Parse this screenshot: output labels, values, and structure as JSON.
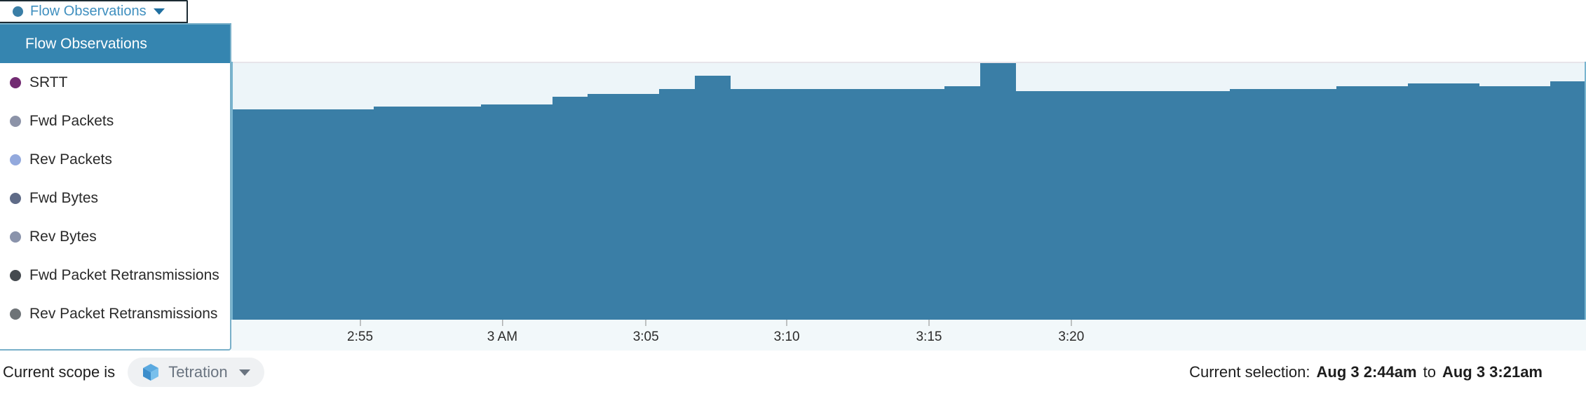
{
  "metric_selector": {
    "selected_label": "Flow Observations",
    "selected_dot_color": "#3a7ea6",
    "caret_icon": "chevron-down-icon",
    "options": [
      {
        "label": "Flow Observations",
        "color": "#3a7ea6",
        "selected": true
      },
      {
        "label": "SRTT",
        "color": "#722b72",
        "selected": false
      },
      {
        "label": "Fwd Packets",
        "color": "#8c93a8",
        "selected": false
      },
      {
        "label": "Rev Packets",
        "color": "#93a9dd",
        "selected": false
      },
      {
        "label": "Fwd Bytes",
        "color": "#5f6b87",
        "selected": false
      },
      {
        "label": "Rev Bytes",
        "color": "#8a93ab",
        "selected": false
      },
      {
        "label": "Fwd Packet Retransmissions",
        "color": "#454a4f",
        "selected": false
      },
      {
        "label": "Rev Packet Retransmissions",
        "color": "#6e7377",
        "selected": false
      }
    ]
  },
  "footer": {
    "scope_label": "Current scope is",
    "scope_name": "Tetration",
    "scope_icon": "cube-icon",
    "scope_caret_icon": "chevron-down-icon",
    "selection_prefix": "Current selection:",
    "selection_start": "Aug 3 2:44am",
    "selection_joiner": "to",
    "selection_end": "Aug 3 3:21am"
  },
  "chart_data": {
    "type": "bar",
    "title": "",
    "xlabel": "",
    "ylabel": "",
    "series_name": "Flow Observations",
    "bar_color": "#3a7ea6",
    "plot_background": "#edf5f9",
    "grid": false,
    "legend": "none",
    "xlim": [
      "2:44am",
      "3:21am"
    ],
    "ylim": [
      0,
      100
    ],
    "tick_labels": [
      "2:55",
      "3 AM",
      "3:05",
      "3:10",
      "3:15",
      "3:20"
    ],
    "tick_positions_pct": [
      9.5,
      20.0,
      30.6,
      41.0,
      51.5,
      62.0
    ],
    "x": [
      "2:44",
      "2:45",
      "2:46",
      "2:47",
      "2:48",
      "2:49",
      "2:50",
      "2:51",
      "2:52",
      "2:53",
      "2:54",
      "2:55",
      "2:56",
      "2:57",
      "2:58",
      "2:59",
      "3:00",
      "3:01",
      "3:02",
      "3:03",
      "3:04",
      "3:05",
      "3:06",
      "3:07",
      "3:08",
      "3:09",
      "3:10",
      "3:11",
      "3:12",
      "3:13",
      "3:14",
      "3:15",
      "3:16",
      "3:17",
      "3:18",
      "3:19",
      "3:20",
      "3:21"
    ],
    "values": [
      82,
      82,
      82,
      82,
      83,
      83,
      83,
      84,
      84,
      87,
      88,
      88,
      90,
      95,
      90,
      90,
      90,
      90,
      90,
      90,
      91,
      100,
      89,
      89,
      89,
      89,
      89,
      89,
      90,
      90,
      90,
      91,
      91,
      92,
      92,
      91,
      91,
      93
    ]
  }
}
